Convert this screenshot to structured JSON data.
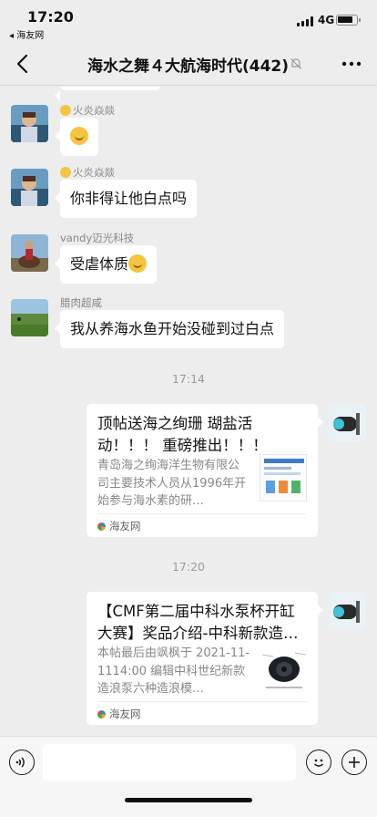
{
  "status": {
    "time": "17:20",
    "back_app": "◂ 海友网",
    "network": "4G",
    "battery_level": 0.85
  },
  "header": {
    "back_icon": "chevron-left-icon",
    "title": "海水之舞４大航海时代(442)",
    "mute_icon": "mute-bell-icon",
    "more_icon": "more-dots-icon"
  },
  "messages": [
    {
      "sender": "火炎焱燚",
      "text": ""
    },
    {
      "sender": "火炎焱燚",
      "text": "你非得让他白点吗"
    },
    {
      "sender": "vandy迈光科技",
      "text": "受虐体质"
    },
    {
      "sender": "腊肉超咸",
      "text": "我从养海水鱼开始没碰到过白点"
    }
  ],
  "timestamps": [
    "17:14",
    "17:20"
  ],
  "cards": [
    {
      "title": "顶帖送海之绚珊 瑚盐活动！！！ 重磅推出！！！",
      "desc": "青岛海之绚海洋生物有限公司主要技术人员从1996年开始参与海水素的研…",
      "source": "海友网"
    },
    {
      "title": "【CMF第二届中科水泵杯开缸大赛】奖品介绍-中科新款造…",
      "desc": "本帖最后由飒枫于 2021-11-1114:00 编辑中科世纪新款造浪泵六种造浪模…",
      "source": "海友网"
    }
  ],
  "input": {
    "voice_icon": "voice-icon",
    "placeholder": "",
    "emoji_icon": "emoji-icon",
    "plus_icon": "plus-icon"
  },
  "colors": {
    "background": "#ededed",
    "bubble": "#ffffff",
    "timestamp_text": "#9b9b9b"
  }
}
